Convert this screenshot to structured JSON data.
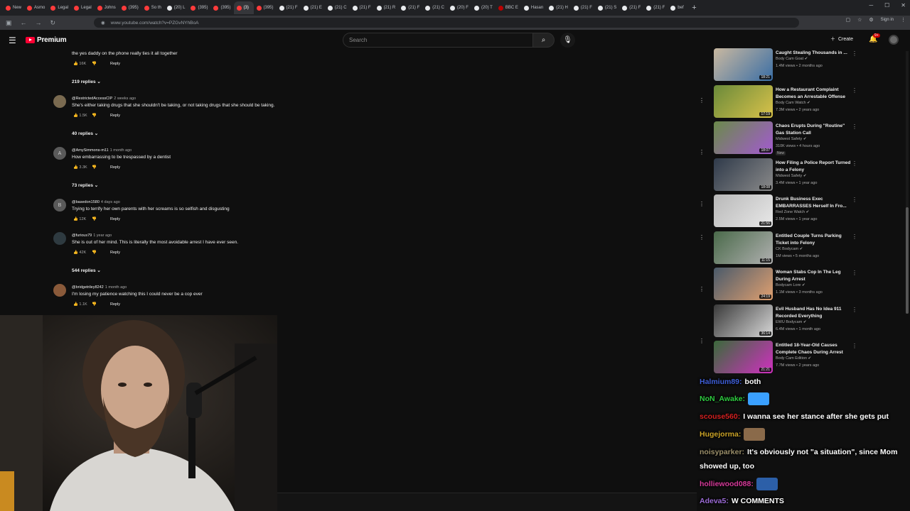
{
  "browser": {
    "tabs": [
      {
        "label": "New",
        "color": "#ff3b3b"
      },
      {
        "label": "Asmo",
        "color": "#ff3b3b"
      },
      {
        "label": "Legal",
        "color": "#ff3b3b"
      },
      {
        "label": "Legal",
        "color": "#ff3b3b"
      },
      {
        "label": "Johns",
        "color": "#ff3b3b"
      },
      {
        "label": "(395)",
        "color": "#ff3b3b"
      },
      {
        "label": "So th",
        "color": "#ff3b3b"
      },
      {
        "label": "(20) L",
        "color": "#e8eaed"
      },
      {
        "label": "(395)",
        "color": "#ff3b3b"
      },
      {
        "label": "(395)",
        "color": "#ff3b3b"
      },
      {
        "label": "(3)",
        "color": "#ff3b3b"
      },
      {
        "label": "(395)",
        "color": "#ff3b3b"
      },
      {
        "label": "(21) F",
        "color": "#e8eaed"
      },
      {
        "label": "(21) E",
        "color": "#e8eaed"
      },
      {
        "label": "(21) C",
        "color": "#e8eaed"
      },
      {
        "label": "(21) F",
        "color": "#e8eaed"
      },
      {
        "label": "(21) R",
        "color": "#e8eaed"
      },
      {
        "label": "(21) F",
        "color": "#e8eaed"
      },
      {
        "label": "(21) C",
        "color": "#e8eaed"
      },
      {
        "label": "(20) F",
        "color": "#e8eaed"
      },
      {
        "label": "(20) T",
        "color": "#e8eaed"
      },
      {
        "label": "BBC E",
        "color": "#b00"
      },
      {
        "label": "Hasan",
        "color": "#e8eaed"
      },
      {
        "label": "(21) H",
        "color": "#e8eaed"
      },
      {
        "label": "(21) F",
        "color": "#e8eaed"
      },
      {
        "label": "(21) S",
        "color": "#e8eaed"
      },
      {
        "label": "(21) F",
        "color": "#e8eaed"
      },
      {
        "label": "(21) F",
        "color": "#e8eaed"
      },
      {
        "label": "bef",
        "color": "#e8eaed"
      }
    ],
    "active_tab_index": 10,
    "url": "www.youtube.com/watch?v=PZGvNYhBoA",
    "signin_label": "Sign in"
  },
  "youtube": {
    "logo_text": "Premium",
    "search_placeholder": "Search",
    "create_label": "Create",
    "notif_count": "9+"
  },
  "comments": [
    {
      "handle": "",
      "ago": "",
      "text": "the yes daddy on the phone really ties it all together",
      "likes": "16K",
      "reply": "Reply",
      "replies": "219 replies",
      "avatar": ""
    },
    {
      "handle": "@RestrictedAccessCIP",
      "ago": "2 weeks ago",
      "text": "She's either taking drugs that she shouldn't be taking, or not taking drugs that she should be taking.",
      "likes": "1.5K",
      "reply": "Reply",
      "replies": "40 replies",
      "avatar": ""
    },
    {
      "handle": "@AmySimmons-m11",
      "ago": "1 month ago",
      "text": "How embarrassing to be trespassed by a dentist",
      "likes": "3.3K",
      "reply": "Reply",
      "replies": "73 replies",
      "avatar": "A"
    },
    {
      "handle": "@basedon1580",
      "ago": "4 days ago",
      "text": "Trying to terrify her own parents with her screams is so selfish and disgusting",
      "likes": "12K",
      "reply": "Reply",
      "replies": "",
      "avatar": "B"
    },
    {
      "handle": "@furious79",
      "ago": "1 year ago",
      "text": "She is out of her mind. This is literally the most avoidable arrest I have ever seen.",
      "likes": "42K",
      "reply": "Reply",
      "replies": "544 replies",
      "avatar": ""
    },
    {
      "handle": "@bridgetriley8242",
      "ago": "1 month ago",
      "text": "I'm losing my patience watching this I could never be a cop ever",
      "likes": "1.1K",
      "reply": "Reply",
      "replies": "",
      "avatar": ""
    }
  ],
  "related": [
    {
      "title": "Caught Stealing Thousands in ...",
      "channel": "Body Cam Goat",
      "meta": "1.4M views • 2 months ago",
      "duration": "18:21",
      "new": ""
    },
    {
      "title": "How a Restaurant Complaint Becomes an Arrestable Offense",
      "channel": "Body Cam Watch",
      "meta": "7.3M views • 2 years ago",
      "duration": "17:19",
      "new": ""
    },
    {
      "title": "Chaos Erupts During \"Routine\" Gas Station Call",
      "channel": "Midwest Safety",
      "meta": "310K views • 4 hours ago",
      "duration": "18:07",
      "new": "New"
    },
    {
      "title": "How Filing a Police Report Turned into a Felony",
      "channel": "Midwest Safety",
      "meta": "3.4M views • 1 year ago",
      "duration": "18:08",
      "new": ""
    },
    {
      "title": "Drunk Business Exec EMBARRASSES Herself In Fro...",
      "channel": "Red Zone Watch",
      "meta": "2.5M views • 1 year ago",
      "duration": "21:56",
      "new": ""
    },
    {
      "title": "Entitled Couple Turns Parking Ticket into Felony",
      "channel": "CK Bodycam",
      "meta": "1M views • 5 months ago",
      "duration": "11:15",
      "new": ""
    },
    {
      "title": "Woman Stabs Cop In The Leg During Arrest",
      "channel": "Bodycam Lore",
      "meta": "1.1M views • 3 months ago",
      "duration": "24:19",
      "new": ""
    },
    {
      "title": "Evil Husband Has No Idea 911 Recorded Everything",
      "channel": "EWU Bodycam",
      "meta": "6.4M views • 1 month ago",
      "duration": "36:14",
      "new": ""
    },
    {
      "title": "Entitled 18-Year-Old Causes Complete Chaos During Arrest",
      "channel": "Body Cam Edition",
      "meta": "7.7M views • 2 years ago",
      "duration": "21:21",
      "new": ""
    }
  ],
  "chat": [
    {
      "user": "Halmium89:",
      "color": "#3f5fd8",
      "msg": "both",
      "emote": ""
    },
    {
      "user": "NoN_Awake:",
      "color": "#2ecc40",
      "msg": "",
      "emote": "#3aa0ff"
    },
    {
      "user": "scouse560:",
      "color": "#d42020",
      "msg": "I wanna see her stance after she gets put",
      "emote": ""
    },
    {
      "user": "Hugejorma:",
      "color": "#c9a227",
      "msg": "",
      "emote": "#8a6a4a"
    },
    {
      "user": "noisyparker:",
      "color": "#9b8f6a",
      "msg": "It's obviously not \"a situation\", since Mom showed up, too",
      "emote": ""
    },
    {
      "user": "holliewood088:",
      "color": "#d63a9a",
      "msg": "",
      "emote": "#2c5fa8"
    },
    {
      "user": "Adeva5:",
      "color": "#9b6bd6",
      "msg": "W COMMENTS",
      "emote": ""
    }
  ]
}
